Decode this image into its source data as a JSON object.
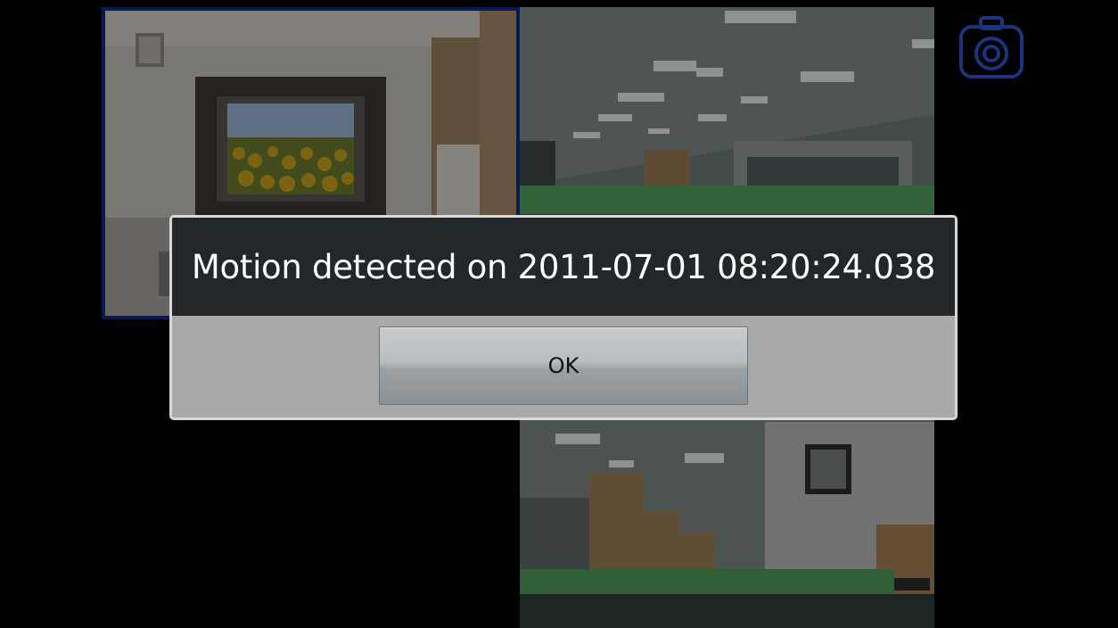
{
  "dialog": {
    "message": "Motion detected on 2011-07-01 08:20:24.038",
    "ok_label": "OK"
  },
  "toolbar": {
    "snapshot_icon": "camera-icon"
  },
  "colors": {
    "selected_border": "#0d2c8a",
    "dialog_header": "#22272a",
    "dialog_body": "#a9a9a9",
    "icon_blue": "#2b56c4"
  }
}
